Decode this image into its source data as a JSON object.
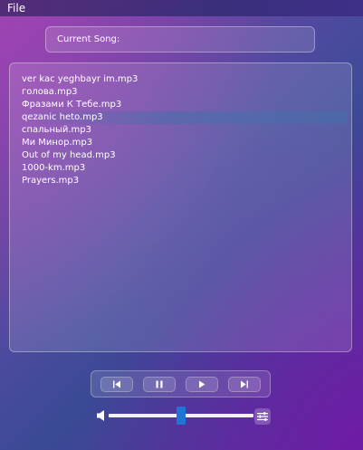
{
  "menu": {
    "file": "File"
  },
  "current_song": {
    "label": "Current Song:"
  },
  "playlist": {
    "tracks": [
      "ver kac yeghbayr im.mp3",
      "голова.mp3",
      "Фразами К Тебе.mp3",
      "qezanic heto.mp3",
      "спальный.mp3",
      "Ми Минор.mp3",
      "Out of my head.mp3",
      "1000-km.mp3",
      "Prayers.mp3"
    ],
    "selected_index": 3
  },
  "controls": {
    "icons": [
      "skip-previous-icon",
      "pause-icon",
      "play-icon",
      "skip-next-icon"
    ]
  },
  "volume": {
    "level": 0.5,
    "icon": "volume-icon",
    "settings_icon": "equalizer-icon"
  },
  "colors": {
    "slider_handle": "#1f74d6",
    "slider_track": "#f2f2f2"
  }
}
